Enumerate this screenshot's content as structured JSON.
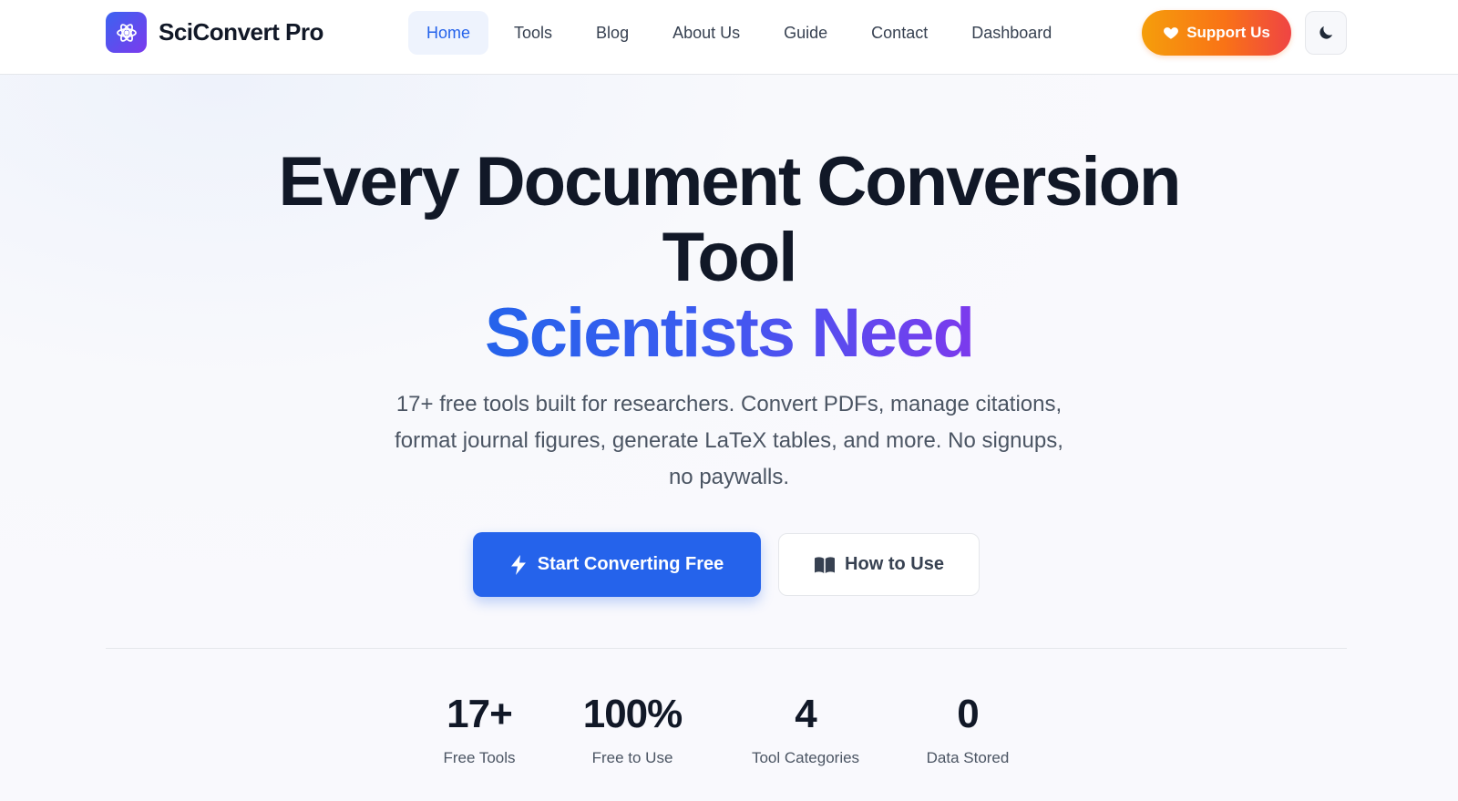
{
  "header": {
    "brand_name": "SciConvert Pro",
    "nav": [
      {
        "label": "Home",
        "active": true
      },
      {
        "label": "Tools"
      },
      {
        "label": "Blog"
      },
      {
        "label": "About Us"
      },
      {
        "label": "Guide"
      },
      {
        "label": "Contact"
      },
      {
        "label": "Dashboard"
      }
    ],
    "support_label": "Support Us",
    "theme_icon": "moon-icon"
  },
  "hero": {
    "title_line1": "Every Document Conversion",
    "title_line2": "Tool",
    "title_highlight": "Scientists Need",
    "subtitle": "17+ free tools built for researchers. Convert PDFs, manage citations, format journal figures, generate LaTeX tables, and more. No signups, no paywalls.",
    "primary_cta": "Start Converting Free",
    "secondary_cta": "How to Use"
  },
  "stats": [
    {
      "value": "17+",
      "label": "Free Tools"
    },
    {
      "value": "100%",
      "label": "Free to Use"
    },
    {
      "value": "4",
      "label": "Tool Categories"
    },
    {
      "value": "0",
      "label": "Data Stored"
    }
  ],
  "colors": {
    "accent": "#2563eb",
    "brand_gradient_start": "#3b63f0",
    "brand_gradient_end": "#7c3aed",
    "support_gradient_start": "#f59e0b",
    "support_gradient_end": "#ef4444"
  }
}
